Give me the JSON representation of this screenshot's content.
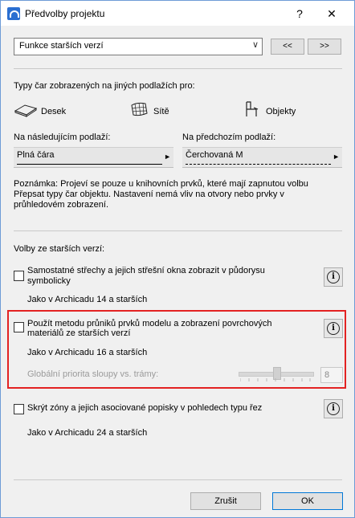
{
  "window": {
    "title": "Předvolby projektu",
    "help_label": "?",
    "close_label": "✕"
  },
  "toolbar": {
    "dropdown_value": "Funkce starších verzí",
    "prev_label": "<<",
    "next_label": ">>"
  },
  "line_types": {
    "heading": "Typy čar zobrazených na jiných podlažích pro:",
    "modes": [
      {
        "label": "Desek",
        "icon": "slab-icon"
      },
      {
        "label": "Sítě",
        "icon": "mesh-icon"
      },
      {
        "label": "Objekty",
        "icon": "chair-icon"
      }
    ],
    "next_label": "Na následujícím podlaží:",
    "prev_label": "Na předchozím podlaží:",
    "next_value": "Plná čára",
    "prev_value": "Čerchovaná M"
  },
  "note": {
    "line1": "Poznámka: Projeví se pouze u knihovních prvků, které mají zapnutou volbu",
    "line2": "Přepsat typy čar objektu. Nastavení nemá vliv na otvory nebo prvky v",
    "line3": "průhledovém zobrazení."
  },
  "legacy": {
    "heading": "Volby ze starších verzí:",
    "options": [
      {
        "line1": "Samostatné střechy a jejich střešní okna zobrazit v půdorysu",
        "line2": "symbolicky",
        "sub": "Jako v Archicadu 14 a starších",
        "checked": false
      },
      {
        "line1": "Použít metodu průniků prvků modelu a zobrazení povrchových",
        "line2": "materiálů ze starších verzí",
        "sub": "Jako v Archicadu 16 a starších",
        "checked": false
      },
      {
        "line1": "Skrýt zóny a jejich asociované popisky v pohledech typu řez",
        "line2": "",
        "sub": "Jako v Archicadu 24 a starších",
        "checked": false
      }
    ],
    "priority_label": "Globální priorita sloupy vs. trámy:",
    "priority_value": "8"
  },
  "footer": {
    "cancel_label": "Zrušit",
    "ok_label": "OK"
  },
  "colors": {
    "highlight": "#e32222",
    "accent": "#0078d7"
  }
}
